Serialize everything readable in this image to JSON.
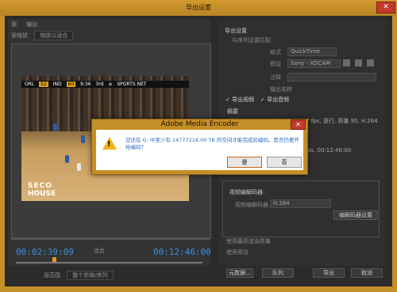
{
  "window": {
    "title": "导出设置",
    "close_glyph": "✕"
  },
  "left": {
    "tabs": [
      "源",
      "输出"
    ],
    "source_scale_label": "源缩放",
    "source_scale_value": "缩放以适合",
    "timecode_in": "00:02:39:09",
    "timecode_out": "00:12:46:00",
    "fit_label": "适合",
    "range_label": "源范围",
    "range_value": "整个剪辑/序列",
    "scoreboard": {
      "team1": "ORL",
      "score1": "52",
      "team2": "IND",
      "score2": "60",
      "clock": "9:36",
      "quarter": "3rd",
      "badge": "≡",
      "network": "SPORTS NET"
    },
    "court_text_1": "SECO",
    "court_text_2": "HOUSE"
  },
  "right": {
    "export_settings_header": "导出设置",
    "match_sequence_label": "与序列设置匹配",
    "format_label": "格式",
    "format_value": "QuickTime",
    "preset_label": "预设",
    "preset_value": "Sony - XDCAM",
    "comments_label": "注释",
    "output_name_label": "输出名称",
    "output_name_value": "",
    "export_video_label": "导出视频",
    "export_audio_label": "导出音频",
    "summary_header": "摘要",
    "summary_output": "输出: 1920x1080 (1.0), 29.97 fps, 逐行, 质量 90, H.264",
    "summary_source": "源: 序列, 1920x1080, 29.97 fps, 00:12:46:00",
    "video_codec_header": "视频编解码器",
    "video_codec_label": "视频编解码器",
    "video_codec_value": "H.264",
    "codec_settings_button": "编解码器设置",
    "max_render_label": "使用最高渲染质量",
    "use_previews_label": "使用预览",
    "meta_button": "元数据...",
    "queue_button": "队列",
    "export_button": "导出",
    "cancel_button": "取消"
  },
  "dialog": {
    "title": "Adobe Media Encoder",
    "close_glyph": "✕",
    "message": "您还在 G: 中至少有 14777216.00 TB 的空间才能完成此编码。是否仍要开始编码？",
    "ok_label": "是",
    "no_label": "否"
  },
  "colors": {
    "accent_orange": "#c58f27",
    "timecode_blue": "#3d8fe0",
    "close_red": "#c43a2b"
  }
}
